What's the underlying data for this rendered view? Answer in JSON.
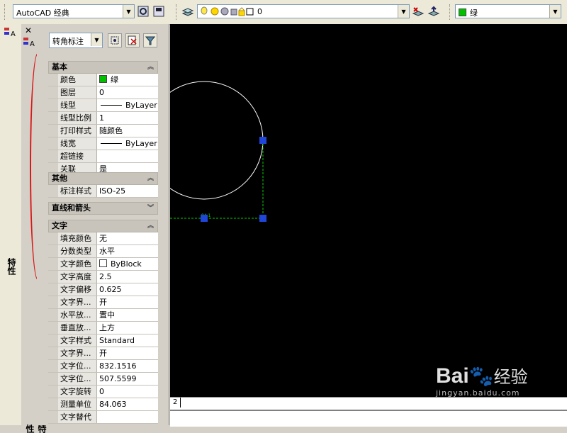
{
  "toolbar": {
    "workspace_value": "AutoCAD 经典",
    "layer_value": "0",
    "color_value": "绿",
    "color_hex": "#00c000"
  },
  "palette": {
    "title": "特性",
    "object_type": "转角标注",
    "sections": [
      {
        "title": "基本",
        "collapsed": false,
        "rows": [
          {
            "name": "颜色",
            "value": "绿",
            "swatch": "#00c000"
          },
          {
            "name": "图层",
            "value": "0"
          },
          {
            "name": "线型",
            "value": "ByLayer",
            "line": true
          },
          {
            "name": "线型比例",
            "value": "1"
          },
          {
            "name": "打印样式",
            "value": "随颜色"
          },
          {
            "name": "线宽",
            "value": "ByLayer",
            "line": true
          },
          {
            "name": "超链接",
            "value": ""
          },
          {
            "name": "关联",
            "value": "是"
          }
        ]
      },
      {
        "title": "其他",
        "collapsed": false,
        "rows": [
          {
            "name": "标注样式",
            "value": "ISO-25"
          }
        ]
      },
      {
        "title": "直线和箭头",
        "collapsed": true,
        "rows": []
      },
      {
        "title": "文字",
        "collapsed": false,
        "rows": [
          {
            "name": "填充颜色",
            "value": "无"
          },
          {
            "name": "分数类型",
            "value": "水平"
          },
          {
            "name": "文字颜色",
            "value": "ByBlock",
            "swatch": "#ffffff"
          },
          {
            "name": "文字高度",
            "value": "2.5"
          },
          {
            "name": "文字偏移",
            "value": "0.625"
          },
          {
            "name": "文字界...",
            "value": "开"
          },
          {
            "name": "水平放...",
            "value": "置中"
          },
          {
            "name": "垂直放...",
            "value": "上方"
          },
          {
            "name": "文字样式",
            "value": "Standard"
          },
          {
            "name": "文字界...",
            "value": "开"
          },
          {
            "name": "文字位...",
            "value": "832.1516"
          },
          {
            "name": "文字位...",
            "value": "507.5599"
          },
          {
            "name": "文字旋转",
            "value": "0"
          },
          {
            "name": "测量单位",
            "value": "84.063"
          },
          {
            "name": "文字替代",
            "value": ""
          }
        ]
      }
    ]
  },
  "left_strip": {
    "label": "特性"
  },
  "drawing": {
    "layout_tab": "2"
  },
  "watermark": {
    "brand": "Bai",
    "brand_cn": "经验",
    "url": "jingyan.baidu.com"
  }
}
